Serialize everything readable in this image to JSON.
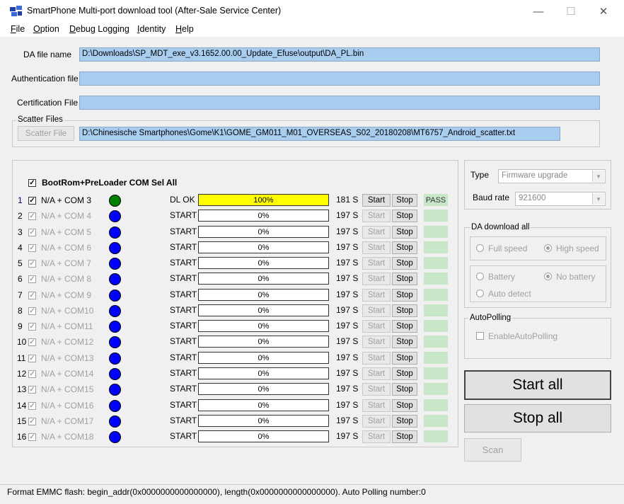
{
  "window": {
    "title": "SmartPhone Multi-port download tool (After-Sale Service Center)",
    "minimize": "—",
    "maximize": "☐",
    "close": "✕"
  },
  "menu": [
    "File",
    "Option",
    "Debug Logging",
    "Identity",
    "Help"
  ],
  "files": {
    "da_label": "DA file name",
    "da_value": "D:\\Downloads\\SP_MDT_exe_v3.1652.00.00_Update_Efuse\\output\\DA_PL.bin",
    "auth_label": "Authentication file",
    "auth_value": "",
    "cert_label": "Certification File",
    "cert_value": "",
    "scatter_group": "Scatter Files",
    "scatter_button": "Scatter File",
    "scatter_value": "D:\\Chinesische Smartphones\\Gome\\K1\\GOME_GM011_M01_OVERSEAS_S02_20180208\\MT6757_Android_scatter.txt"
  },
  "ports": {
    "sel_all_label": "BootRom+PreLoader COM Sel All",
    "rows": [
      {
        "num": "1",
        "com": "N/A + COM 3",
        "status": "DL OK",
        "progress": "100%",
        "progress_value": 100,
        "time": "181 S",
        "start": "Start",
        "stop": "Stop",
        "result": "PASS",
        "active": true
      },
      {
        "num": "2",
        "com": "N/A + COM 4",
        "status": "START",
        "progress": "0%",
        "progress_value": 0,
        "time": "197 S",
        "start": "Start",
        "stop": "Stop",
        "result": "",
        "active": false
      },
      {
        "num": "3",
        "com": "N/A + COM 5",
        "status": "START",
        "progress": "0%",
        "progress_value": 0,
        "time": "197 S",
        "start": "Start",
        "stop": "Stop",
        "result": "",
        "active": false
      },
      {
        "num": "4",
        "com": "N/A + COM 6",
        "status": "START",
        "progress": "0%",
        "progress_value": 0,
        "time": "197 S",
        "start": "Start",
        "stop": "Stop",
        "result": "",
        "active": false
      },
      {
        "num": "5",
        "com": "N/A + COM 7",
        "status": "START",
        "progress": "0%",
        "progress_value": 0,
        "time": "197 S",
        "start": "Start",
        "stop": "Stop",
        "result": "",
        "active": false
      },
      {
        "num": "6",
        "com": "N/A + COM 8",
        "status": "START",
        "progress": "0%",
        "progress_value": 0,
        "time": "197 S",
        "start": "Start",
        "stop": "Stop",
        "result": "",
        "active": false
      },
      {
        "num": "7",
        "com": "N/A + COM 9",
        "status": "START",
        "progress": "0%",
        "progress_value": 0,
        "time": "197 S",
        "start": "Start",
        "stop": "Stop",
        "result": "",
        "active": false
      },
      {
        "num": "8",
        "com": "N/A + COM10",
        "status": "START",
        "progress": "0%",
        "progress_value": 0,
        "time": "197 S",
        "start": "Start",
        "stop": "Stop",
        "result": "",
        "active": false
      },
      {
        "num": "9",
        "com": "N/A + COM11",
        "status": "START",
        "progress": "0%",
        "progress_value": 0,
        "time": "197 S",
        "start": "Start",
        "stop": "Stop",
        "result": "",
        "active": false
      },
      {
        "num": "10",
        "com": "N/A + COM12",
        "status": "START",
        "progress": "0%",
        "progress_value": 0,
        "time": "197 S",
        "start": "Start",
        "stop": "Stop",
        "result": "",
        "active": false
      },
      {
        "num": "11",
        "com": "N/A + COM13",
        "status": "START",
        "progress": "0%",
        "progress_value": 0,
        "time": "197 S",
        "start": "Start",
        "stop": "Stop",
        "result": "",
        "active": false
      },
      {
        "num": "12",
        "com": "N/A + COM14",
        "status": "START",
        "progress": "0%",
        "progress_value": 0,
        "time": "197 S",
        "start": "Start",
        "stop": "Stop",
        "result": "",
        "active": false
      },
      {
        "num": "13",
        "com": "N/A + COM15",
        "status": "START",
        "progress": "0%",
        "progress_value": 0,
        "time": "197 S",
        "start": "Start",
        "stop": "Stop",
        "result": "",
        "active": false
      },
      {
        "num": "14",
        "com": "N/A + COM16",
        "status": "START",
        "progress": "0%",
        "progress_value": 0,
        "time": "197 S",
        "start": "Start",
        "stop": "Stop",
        "result": "",
        "active": false
      },
      {
        "num": "15",
        "com": "N/A + COM17",
        "status": "START",
        "progress": "0%",
        "progress_value": 0,
        "time": "197 S",
        "start": "Start",
        "stop": "Stop",
        "result": "",
        "active": false
      },
      {
        "num": "16",
        "com": "N/A + COM18",
        "status": "START",
        "progress": "0%",
        "progress_value": 0,
        "time": "197 S",
        "start": "Start",
        "stop": "Stop",
        "result": "",
        "active": false
      }
    ]
  },
  "settings": {
    "type_label": "Type",
    "type_value": "Firmware upgrade",
    "baud_label": "Baud rate",
    "baud_value": "921600",
    "da_group": "DA download all",
    "full_speed": "Full speed",
    "high_speed": "High speed",
    "battery": "Battery",
    "no_battery": "No battery",
    "auto_detect": "Auto detect",
    "autopolling_group": "AutoPolling",
    "enable_autopolling": "EnableAutoPolling"
  },
  "actions": {
    "start_all": "Start all",
    "stop_all": "Stop all",
    "scan": "Scan"
  },
  "status": "Format EMMC flash:  begin_addr(0x0000000000000000), length(0x0000000000000000). Auto Polling number:0",
  "colors": {
    "field_bg": "#a9cdef",
    "progress_fill": "#ffff00",
    "dot_idle": "#0000ff",
    "dot_active": "#008000",
    "pass_bg": "#c8e6c8"
  }
}
